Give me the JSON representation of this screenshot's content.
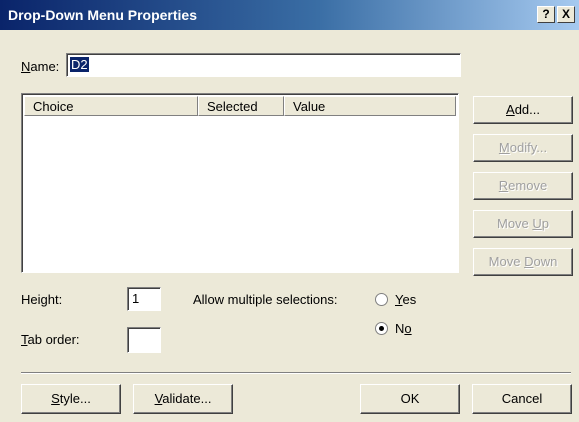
{
  "window": {
    "title": "Drop-Down Menu Properties",
    "help_label": "?",
    "close_label": "X"
  },
  "name": {
    "label_u": "N",
    "label_rest": "ame:",
    "value": "D2"
  },
  "list": {
    "columns": [
      "Choice",
      "Selected",
      "Value"
    ]
  },
  "side_buttons": {
    "add": {
      "u": "A",
      "rest": "dd..."
    },
    "modify": {
      "u": "M",
      "rest": "odify..."
    },
    "remove": {
      "u": "R",
      "rest": "emove"
    },
    "move_up_pre": "Move ",
    "move_up_u": "U",
    "move_up_post": "p",
    "move_down_pre": "Move ",
    "move_down_u": "D",
    "move_down_post": "own"
  },
  "height": {
    "label_pre": "Hei",
    "label_u": "g",
    "label_post": "ht:",
    "value": "1"
  },
  "tab_order": {
    "label_u": "T",
    "label_rest": "ab order:",
    "value": ""
  },
  "allow_multiple": {
    "label": "Allow multiple selections:",
    "yes_u": "Y",
    "yes_rest": "es",
    "no_pre": "N",
    "no_u": "o",
    "selected": "No"
  },
  "bottom_buttons": {
    "style": {
      "u": "S",
      "rest": "tyle..."
    },
    "validate": {
      "u": "V",
      "rest": "alidate..."
    },
    "ok": "OK",
    "cancel": "Cancel"
  }
}
